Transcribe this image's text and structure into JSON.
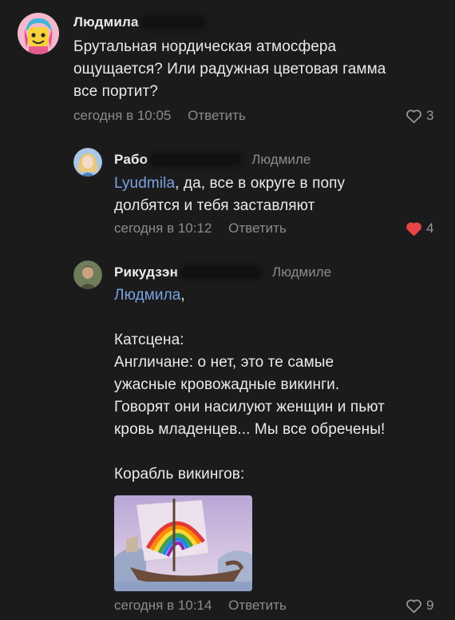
{
  "comments": [
    {
      "author": "Людмила",
      "text_lines": [
        "Брутальная нордическая атмосфера",
        "ощущается? Или радужная цветовая гамма",
        "все портит?"
      ],
      "time": "сегодня в 10:05",
      "reply_label": "Ответить",
      "likes": "3",
      "liked": false,
      "avatar_icon": "lego-figure-avatar"
    },
    {
      "author": "Рабо",
      "reply_to": "Людмиле",
      "mention": "Lyudmila",
      "text_first_rest": ", да, все в округе в попу",
      "text_line2": "долбятся и тебя заставляют",
      "time": "сегодня в 10:12",
      "reply_label": "Ответить",
      "likes": "4",
      "liked": true,
      "avatar_icon": "girl-avatar"
    },
    {
      "author": "Рикудзэн",
      "reply_to": "Людмиле",
      "mention": "Людмила",
      "mention_suffix": ",",
      "lines": [
        "Катсцена:",
        "Англичане: о нет, это те самые",
        "ужасные кровожадные викинги.",
        "Говорят они насилуют женщин и пьют",
        "кровь младенцев... Мы все обречены!",
        "Корабль викингов:"
      ],
      "time": "сегодня в 10:14",
      "reply_label": "Ответить",
      "likes": "9",
      "liked": false,
      "avatar_icon": "man-avatar",
      "image_icon": "rainbow-viking-ship-image"
    }
  ],
  "colors": {
    "background": "#1b1b1c",
    "mention": "#7aa2e0",
    "meta": "#8b8b8e",
    "liked_heart": "#e64646"
  }
}
